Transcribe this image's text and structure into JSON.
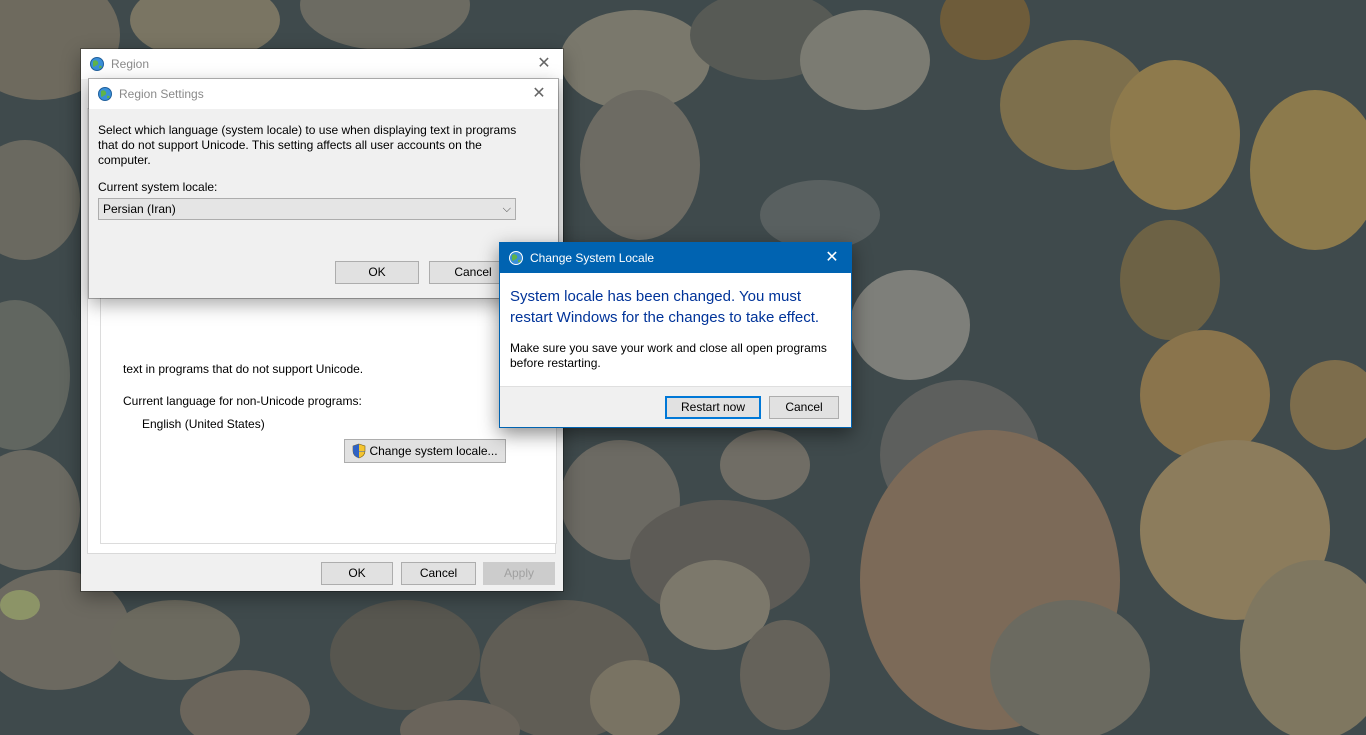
{
  "desktop": {
    "wallpaper": "river-stones"
  },
  "region_window": {
    "title": "Region",
    "non_unicode_text_fragment": "text in programs that do not support Unicode.",
    "current_language_label": "Current language for non-Unicode programs:",
    "current_language_value": "English (United States)",
    "change_locale_button": "Change system locale...",
    "buttons": {
      "ok": "OK",
      "cancel": "Cancel",
      "apply": "Apply"
    }
  },
  "region_settings_window": {
    "title": "Region Settings",
    "description": "Select which language (system locale) to use when displaying text in programs that do not support Unicode. This setting affects all user accounts on the computer.",
    "current_locale_label": "Current system locale:",
    "selected_locale": "Persian (Iran)",
    "buttons": {
      "ok": "OK",
      "cancel": "Cancel"
    }
  },
  "change_locale_dialog": {
    "title": "Change System Locale",
    "main_instruction": "System locale has been changed. You must restart Windows for the changes to take effect.",
    "content": "Make sure you save your work and close all open programs before restarting.",
    "buttons": {
      "restart": "Restart now",
      "cancel": "Cancel"
    },
    "accent_color": "#0063b1",
    "instruction_color": "#003399"
  }
}
